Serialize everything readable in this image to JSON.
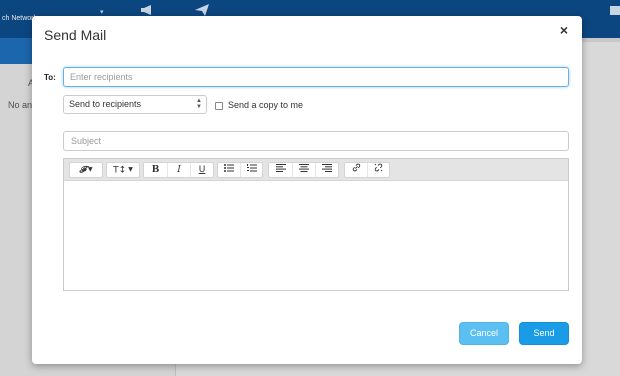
{
  "background": {
    "network_label": "ch Network",
    "left_letter": "A",
    "left_text": "No an"
  },
  "modal": {
    "title": "Send Mail",
    "close_icon": "×",
    "to_label": "To:",
    "to_placeholder": "Enter recipients",
    "to_value": "",
    "send_mode": {
      "selected": "Send to recipients",
      "options": [
        "Send to recipients"
      ]
    },
    "copy_checkbox": {
      "label": "Send a copy to me",
      "checked": false
    },
    "subject_placeholder": "Subject",
    "subject_value": "",
    "toolbar": {
      "font_family_glyph": "𝓕",
      "font_size_glyph": "T↕",
      "bold": "B",
      "italic": "I",
      "underline": "U",
      "bullet_list_glyph": "☰",
      "numbered_list_glyph": "⒈",
      "align_left_glyph": "≡",
      "align_center_glyph": "≡",
      "align_right_glyph": "≡",
      "link_glyph": "🔗",
      "unlink_glyph": "⛓"
    },
    "buttons": {
      "cancel": "Cancel",
      "send": "Send"
    }
  },
  "colors": {
    "topbar": "#0e4d8c",
    "accent": "#1a9be6",
    "cancel": "#5bc0f1"
  }
}
